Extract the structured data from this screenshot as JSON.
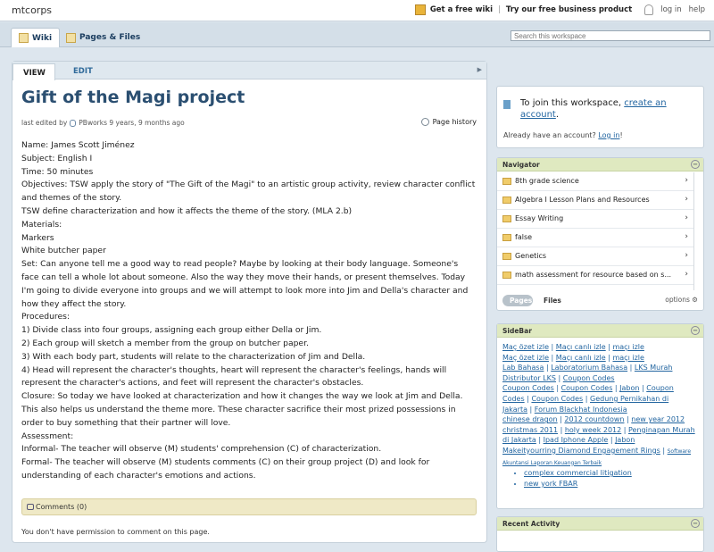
{
  "topbar": {
    "brand": "mtcorps",
    "get_wiki": "Get a free wiki",
    "try_business": "Try our free business product",
    "login": "log in",
    "help": "help"
  },
  "nav": {
    "wiki_tab": "Wiki",
    "pages_tab": "Pages & Files",
    "search_placeholder": "Search this workspace"
  },
  "page": {
    "view_tab": "VIEW",
    "edit_tab": "EDIT",
    "title": "Gift of the Magi project",
    "last_edited_prefix": "last edited by",
    "last_edited_user": "PBworks",
    "last_edited_time": "9 years, 9 months ago",
    "page_history": "Page history",
    "body": [
      "Name: James Scott Jiménez",
      "Subject: English I",
      "Time: 50 minutes",
      "Objectives: TSW apply the story of \"The Gift of the Magi\" to an artistic group activity, review character conflict and themes of the story.",
      "TSW define characterization and how it affects the theme of the story. (MLA 2.b)",
      "Materials:",
      "Markers",
      "White butcher paper",
      "Set: Can anyone tell me a good way to read people? Maybe by looking at their body language. Someone's face can tell a whole lot about someone. Also the way they move their hands, or present themselves. Today I'm going to divide everyone into groups and we will attempt to look more into Jim and Della's character and how they affect the story.",
      "Procedures:",
      "1) Divide class into four groups, assigning each group either Della or Jim.",
      "2) Each group will sketch a member from the group on butcher paper.",
      "3) With each body part, students will relate to the characterization of Jim and Della.",
      "4) Head will represent the character's thoughts, heart will represent the character's feelings, hands will represent the character's actions, and feet will represent the character's obstacles.",
      "Closure: So today we have looked at characterization and how it changes the way we look at Jim and Della. This also helps us understand the theme more. These character sacrifice their most prized possessions in order to buy something that their partner will love.",
      "Assessment:",
      "Informal- The teacher will observe (M) students' comprehension (C) of characterization.",
      "Formal- The teacher will observe (M) students comments (C) on their group project (D) and look for understanding of each character's emotions and actions."
    ],
    "comments": "Comments (0)",
    "no_permission": "You don't have permission to comment on this page."
  },
  "sidebar": {
    "join_text": "To join this workspace,",
    "join_link": "create an account",
    "join_end": ".",
    "already": "Already have an account?",
    "login_link": "Log in",
    "already_end": "!",
    "navigator_title": "Navigator",
    "navigator_items": [
      "8th grade science",
      "Algebra I Lesson Plans and Resources",
      "Essay Writing",
      "false",
      "Genetics",
      "math assessment for resource based on s..."
    ],
    "pages_pill": "Pages",
    "files_label": "Files",
    "options_label": "options",
    "sidebar_title": "SideBar",
    "sidebar_lines": [
      [
        "Maç özet izle",
        "Maçı canlı izle",
        "maçı izle"
      ],
      [
        "Maç özet izle",
        "Maçı canlı izle",
        "maçı izle"
      ],
      [
        "Lab Bahasa",
        "Laboratorium Bahasa",
        "LKS Murah"
      ],
      [
        "Distributor LKS",
        "Coupon Codes"
      ],
      [
        "Coupon Codes",
        "Coupon Codes",
        "Jabon",
        "Coupon"
      ],
      [
        "Codes",
        "Coupon Codes",
        "Gedung Pernikahan di"
      ],
      [
        "Jakarta",
        "Forum Blackhat Indonesia"
      ],
      [
        "chinese dragon",
        "2012 countdown",
        "new year 2012"
      ],
      [
        "christmas 2011",
        "holy week 2012",
        "Penginapan Murah"
      ],
      [
        "di Jakarta",
        "Ipad Iphone Apple",
        "Jabon"
      ],
      [
        "Makeityourring Diamond Engagement Rings",
        "Software"
      ],
      [
        "Akuntansi Laporan Keuangan Terbaik"
      ]
    ],
    "sidebar_bullets": [
      "complex commercial litigation",
      "new york FBAR"
    ],
    "recent_title": "Recent Activity"
  },
  "colors": {
    "title": "#2b4f71",
    "link": "#2265a0",
    "panel_head": "#dfe9c0",
    "comments_bg": "#efe9c6"
  }
}
